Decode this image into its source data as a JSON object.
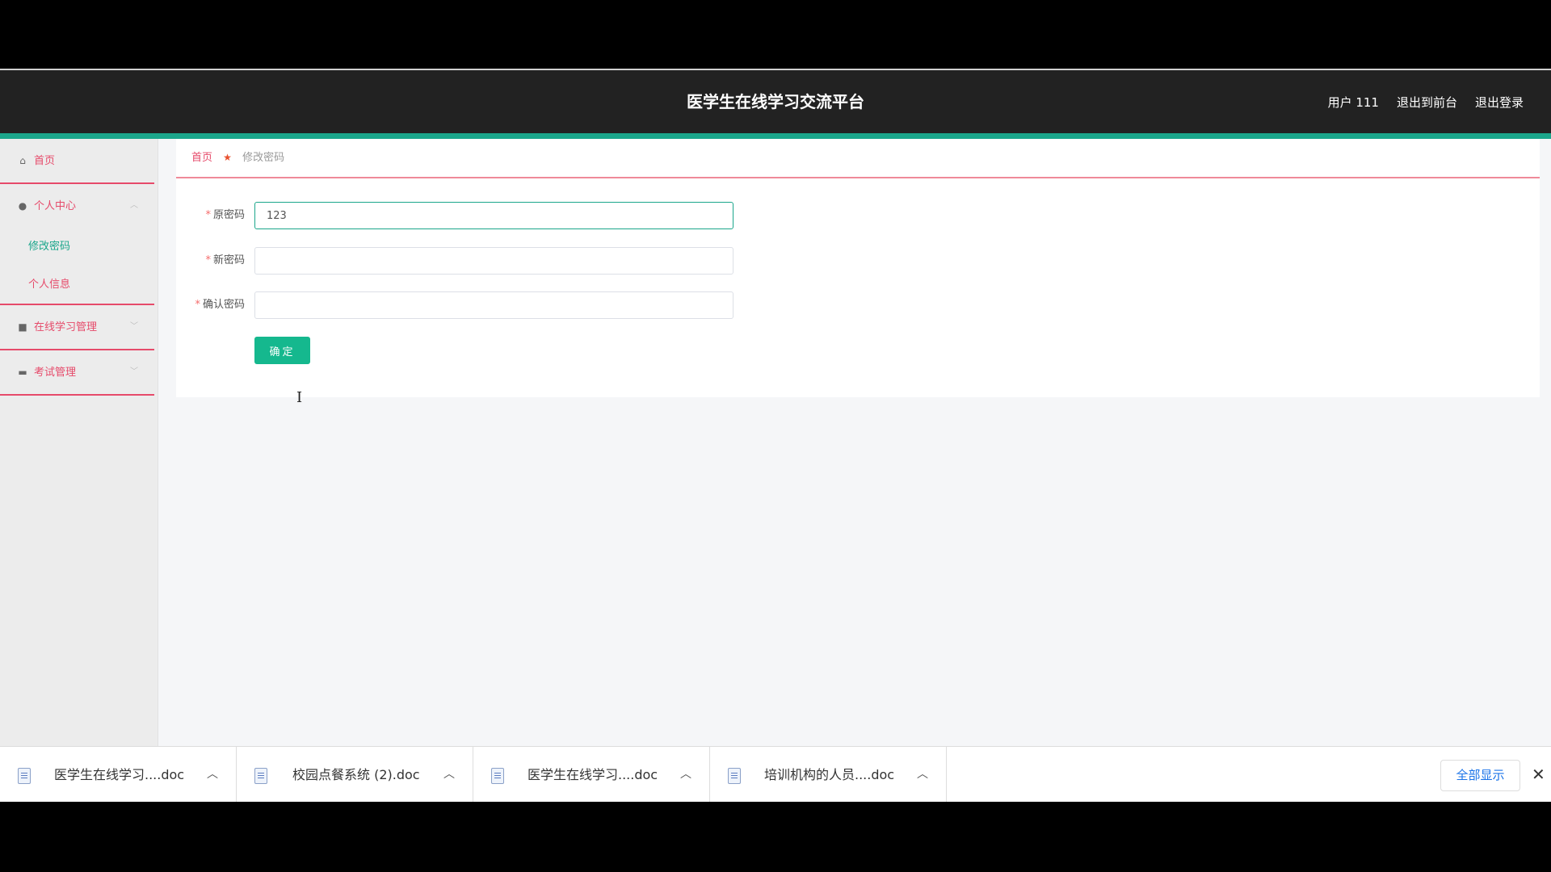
{
  "header": {
    "title": "医学生在线学习交流平台",
    "user_label": "用户 111",
    "exit_front_label": "退出到前台",
    "logout_label": "退出登录"
  },
  "sidebar": {
    "home": "首页",
    "personal_center": "个人中心",
    "change_password": "修改密码",
    "personal_info": "个人信息",
    "online_learning": "在线学习管理",
    "exam_management": "考试管理"
  },
  "breadcrumb": {
    "home": "首页",
    "current": "修改密码"
  },
  "form": {
    "old_password_label": "原密码",
    "old_password_value": "123",
    "new_password_label": "新密码",
    "new_password_value": "",
    "confirm_password_label": "确认密码",
    "confirm_password_value": "",
    "submit_label": "确定"
  },
  "downloads": {
    "items": [
      {
        "name": "医学生在线学习....doc"
      },
      {
        "name": "校园点餐系统 (2).doc"
      },
      {
        "name": "医学生在线学习....doc"
      },
      {
        "name": "培训机构的人员....doc"
      }
    ],
    "show_all_label": "全部显示"
  },
  "colors": {
    "accent": "#1ba68b",
    "menu_red": "#e64a6a",
    "button_green": "#15b88e",
    "header_bg": "#222222"
  }
}
